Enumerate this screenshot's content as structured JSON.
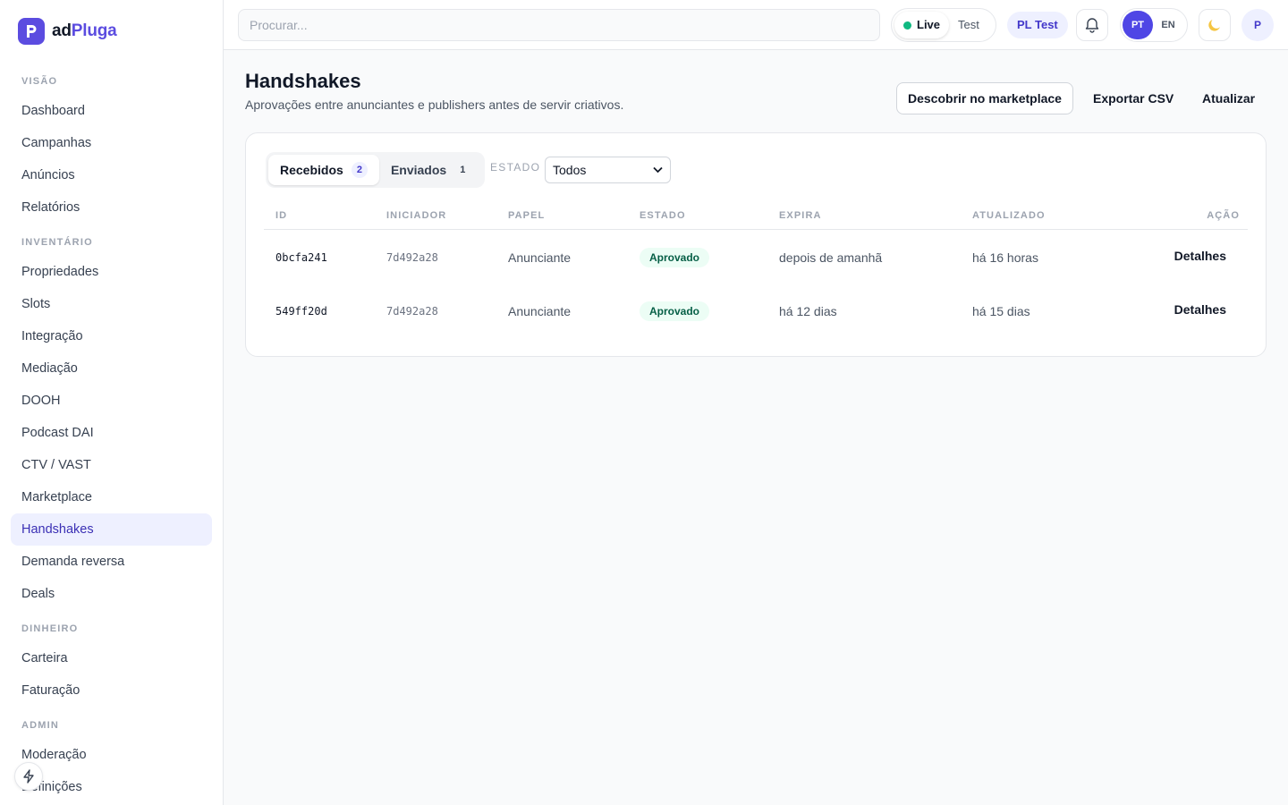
{
  "brand": {
    "prefix": "ad",
    "accent": "Pluga",
    "logo_letter": "P"
  },
  "sidebar": {
    "sections": [
      {
        "title": "VISÃO",
        "items": [
          "Dashboard",
          "Campanhas",
          "Anúncios",
          "Relatórios"
        ]
      },
      {
        "title": "INVENTÁRIO",
        "items": [
          "Propriedades",
          "Slots",
          "Integração",
          "Mediação",
          "DOOH",
          "Podcast DAI",
          "CTV / VAST",
          "Marketplace",
          "Handshakes",
          "Demanda reversa",
          "Deals"
        ]
      },
      {
        "title": "DINHEIRO",
        "items": [
          "Carteira",
          "Faturação"
        ]
      },
      {
        "title": "ADMIN",
        "items": [
          "Moderação",
          "Definições"
        ]
      }
    ],
    "active_item": "Handshakes"
  },
  "topbar": {
    "search_placeholder": "Procurar...",
    "mode": {
      "live": "Live",
      "test": "Test",
      "selected": "Live"
    },
    "org_badge": "PL Test",
    "lang": {
      "pt": "PT",
      "en": "EN",
      "selected": "PT"
    },
    "avatar": "P"
  },
  "page": {
    "title": "Handshakes",
    "subtitle": "Aprovações entre anunciantes e publishers antes de servir criativos.",
    "actions": {
      "discover": "Descobrir no marketplace",
      "export": "Exportar CSV",
      "refresh": "Atualizar"
    }
  },
  "filters": {
    "tabs": [
      {
        "label": "Recebidos",
        "count": "2",
        "selected": true
      },
      {
        "label": "Enviados",
        "count": "1",
        "selected": false
      }
    ],
    "state_label": "ESTADO",
    "state_value": "Todos"
  },
  "table": {
    "columns": [
      "ID",
      "INICIADOR",
      "PAPEL",
      "ESTADO",
      "EXPIRA",
      "ATUALIZADO",
      "AÇÃO"
    ],
    "rows": [
      {
        "id": "0bcfa241",
        "initiator": "7d492a28",
        "role": "Anunciante",
        "status": "Aprovado",
        "expires": "depois de amanhã",
        "updated": "há 16 horas",
        "action": "Detalhes"
      },
      {
        "id": "549ff20d",
        "initiator": "7d492a28",
        "role": "Anunciante",
        "status": "Aprovado",
        "expires": "há 12 dias",
        "updated": "há 15 dias",
        "action": "Detalhes"
      }
    ]
  },
  "colors": {
    "brand": "#5b4ce0",
    "active_nav_bg": "#eef0ff",
    "status_green": "#10b981"
  }
}
